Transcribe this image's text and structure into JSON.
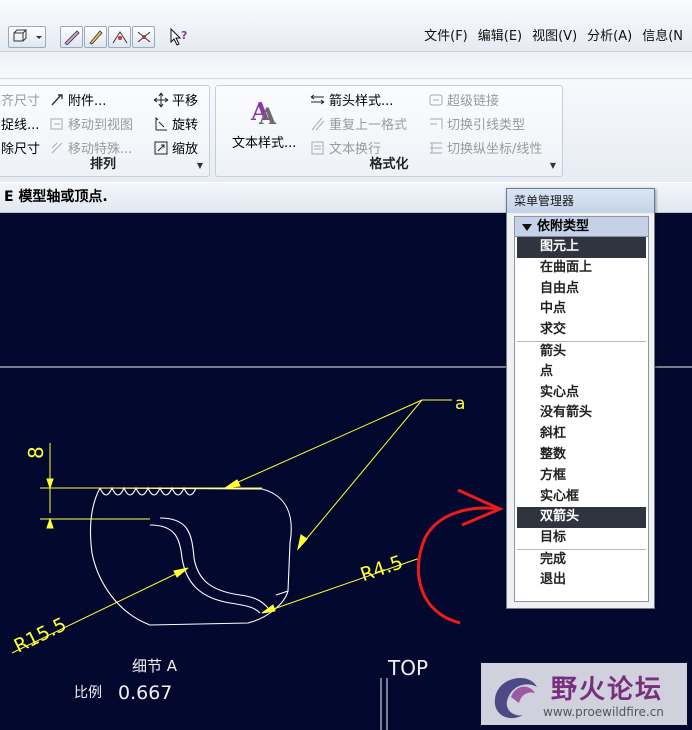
{
  "menubar": {
    "items": [
      "文件(F)",
      "编辑(E)",
      "视图(V)",
      "分析(A)",
      "信息(N"
    ]
  },
  "ribbon": {
    "arrange_group": {
      "title": "排列",
      "commands": [
        "齐尺寸",
        "捉线...",
        "除尺寸",
        "附件...",
        "移动到视图",
        "移动特殊...",
        "平移",
        "旋转",
        "缩放"
      ]
    },
    "format_group": {
      "title": "格式化",
      "commands": [
        "文本样式...",
        "箭头样式...",
        "重复上一格式",
        "文本换行",
        "超级链接",
        "切换引线类型",
        "切换纵坐标/线性"
      ]
    }
  },
  "status_text": "E 模型轴或顶点.",
  "cad": {
    "dims": [
      "8",
      "R4.5",
      "R15.5"
    ],
    "detail_label": "细节 A",
    "scale_label": "比例",
    "scale_value": "0.667",
    "view_label": "TOP",
    "leader_tag": "a"
  },
  "menu_manager": {
    "title": "菜单管理器",
    "header": "依附类型",
    "items": [
      {
        "label": "图元上",
        "selected": true
      },
      {
        "label": "在曲面上"
      },
      {
        "label": "自由点"
      },
      {
        "label": "中点"
      },
      {
        "label": "求交"
      },
      {
        "label": "箭头",
        "separator": true
      },
      {
        "label": "点"
      },
      {
        "label": "实心点"
      },
      {
        "label": "没有箭头"
      },
      {
        "label": "斜杠"
      },
      {
        "label": "整数"
      },
      {
        "label": "方框"
      },
      {
        "label": "实心框"
      },
      {
        "label": "双箭头",
        "selected": true
      },
      {
        "label": "目标"
      },
      {
        "label": "完成",
        "separator": true
      },
      {
        "label": "退出"
      }
    ]
  },
  "watermark": {
    "title": "野火论坛",
    "url": "www.proewildfire.cn"
  },
  "colors": {
    "canvas": "#03092e",
    "geometry": "#ffffff",
    "annotation": "#ffff00",
    "markup": "#ff0000"
  }
}
